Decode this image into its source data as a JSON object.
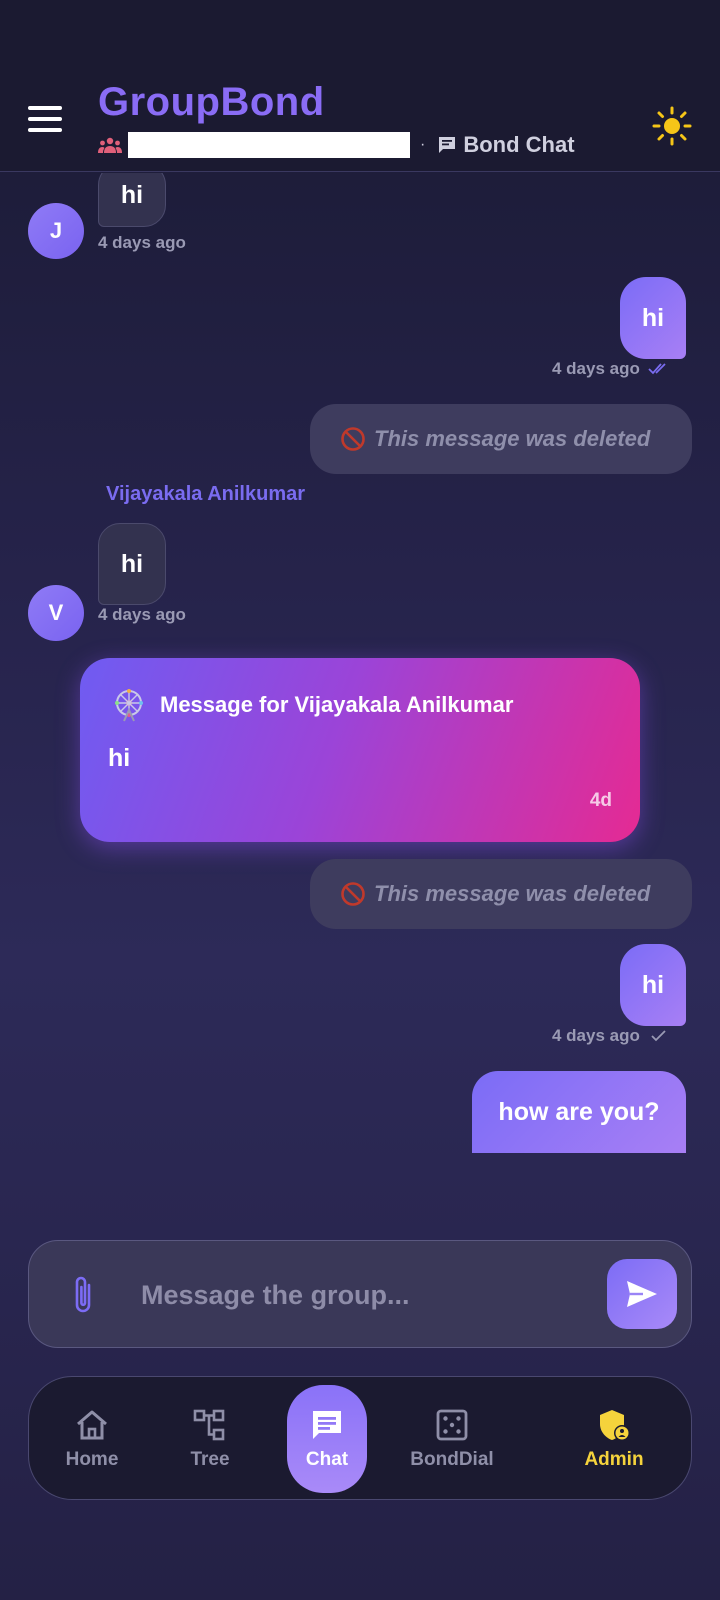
{
  "header": {
    "app_title": "GroupBond",
    "group_name": "",
    "section_label": "Bond Chat"
  },
  "messages": [
    {
      "type": "incoming",
      "avatar_initial": "J",
      "text": "hi",
      "time": "4 days ago"
    },
    {
      "type": "outgoing",
      "text": "hi",
      "time": "4 days ago",
      "status": "read"
    },
    {
      "type": "deleted",
      "text": "This message was deleted"
    },
    {
      "type": "incoming",
      "sender": "Vijayakala Anilkumar",
      "avatar_initial": "V",
      "text": "hi",
      "time": "4 days ago"
    },
    {
      "type": "special",
      "title": "Message for Vijayakala Anilkumar",
      "text": "hi",
      "time": "4d"
    },
    {
      "type": "deleted",
      "text": "This message was deleted"
    },
    {
      "type": "outgoing",
      "text": "hi",
      "time": "4 days ago",
      "status": "sent"
    },
    {
      "type": "outgoing",
      "text": "how are you?"
    }
  ],
  "composer": {
    "placeholder": "Message the group..."
  },
  "nav": [
    {
      "label": "Home",
      "icon": "home-icon"
    },
    {
      "label": "Tree",
      "icon": "tree-icon"
    },
    {
      "label": "Chat",
      "icon": "chat-icon",
      "active": true
    },
    {
      "label": "BondDial",
      "icon": "dice-icon"
    },
    {
      "label": "Admin",
      "icon": "admin-shield-icon"
    }
  ],
  "colors": {
    "accent": "#8a6cf5",
    "admin": "#f5d33c",
    "card_start": "#6f5cf2",
    "card_end": "#e52a93"
  }
}
